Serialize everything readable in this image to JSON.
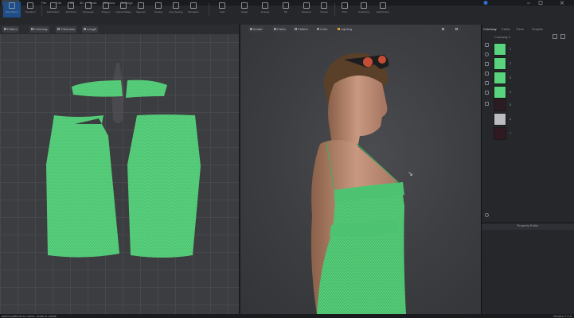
{
  "menubar": {
    "items": [
      "File",
      "Edit",
      "2D",
      "3D",
      "Tools",
      "Window",
      "Settings"
    ],
    "search_label": "Q"
  },
  "toolbar": {
    "tools": [
      "Select/Move",
      "Transform",
      "Edit Pattern",
      "Add Point",
      "Rectangle",
      "Polygon",
      "Internal Shape",
      "Segment",
      "Sewing",
      "Free Sewing",
      "Simulation",
      "Fold",
      "Avatar",
      "Arrange",
      "Pin",
      "Measure",
      "Texture",
      "Print",
      "Puckering",
      "Edit Texture"
    ]
  },
  "view2d": {
    "buttons": [
      "Pattern",
      "Colorway",
      "Thickness",
      "Length"
    ]
  },
  "view3d": {
    "buttons": [
      "Avatar",
      "Fabric",
      "Pattern",
      "Color",
      "Lighting"
    ],
    "cursor_label": "↘"
  },
  "panel": {
    "tabs": [
      "Colorway",
      "Fabric",
      "Trims",
      "Graphic"
    ],
    "colorway_name": "Colorway 1",
    "swatches": [
      {
        "index": "1",
        "color": "#5ad37f"
      },
      {
        "index": "2",
        "color": "#5ad37f"
      },
      {
        "index": "3",
        "color": "#5ad37f"
      },
      {
        "index": "4",
        "color": "#5ad37f"
      },
      {
        "index": "5",
        "color": "#2a1c22"
      },
      {
        "index": "6",
        "color": "#b9bcc0"
      },
      {
        "index": "7",
        "color": "#2e1a20"
      }
    ],
    "property_editor": "Property Editor"
  },
  "status": {
    "message": "select patterns to move, scale or rotate",
    "version": "Version 7.0.0"
  },
  "colors": {
    "fabric_green": "#5ad37f",
    "accent_blue": "#1f4f8a"
  }
}
